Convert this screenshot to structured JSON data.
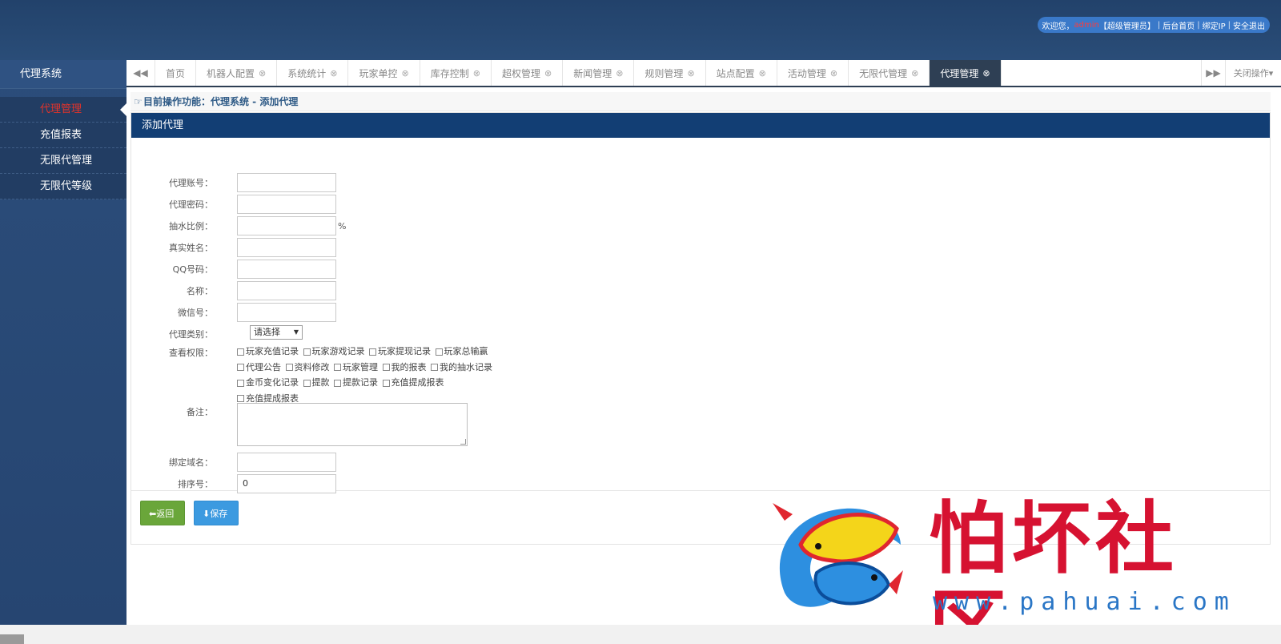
{
  "header": {
    "welcome": "欢迎您，",
    "username": "admin",
    "role": "【超级管理员】",
    "links": [
      "后台首页",
      "绑定IP",
      "安全退出"
    ]
  },
  "sidebar": {
    "title": "代理系统",
    "items": [
      {
        "label": "代理管理",
        "active": true
      },
      {
        "label": "充值报表"
      },
      {
        "label": "无限代管理"
      },
      {
        "label": "无限代等级"
      }
    ]
  },
  "tabs": [
    {
      "label": "首页",
      "closable": false
    },
    {
      "label": "机器人配置",
      "closable": true
    },
    {
      "label": "系统统计",
      "closable": true
    },
    {
      "label": "玩家单控",
      "closable": true
    },
    {
      "label": "库存控制",
      "closable": true
    },
    {
      "label": "超权管理",
      "closable": true
    },
    {
      "label": "新闻管理",
      "closable": true
    },
    {
      "label": "规则管理",
      "closable": true
    },
    {
      "label": "站点配置",
      "closable": true
    },
    {
      "label": "活动管理",
      "closable": true
    },
    {
      "label": "无限代管理",
      "closable": true
    },
    {
      "label": "代理管理",
      "closable": true,
      "active": true
    }
  ],
  "tabbar": {
    "close_ops_label": "关闭操作",
    "nav_left_icon": "double-left-arrow",
    "nav_right_icon": "double-right-arrow"
  },
  "breadcrumb": {
    "text": "目前操作功能：代理系统 - 添加代理"
  },
  "panel": {
    "title": "添加代理"
  },
  "form": {
    "account_label": "代理账号：",
    "password_label": "代理密码：",
    "ratio_label": "抽水比例：",
    "ratio_unit": "%",
    "realname_label": "真实姓名：",
    "qq_label": "QQ号码：",
    "name_label": "名称：",
    "wechat_label": "微信号：",
    "type_label": "代理类别：",
    "type_selected": "请选择",
    "perm_label": "查看权限：",
    "permissions": [
      "玩家充值记录",
      "玩家游戏记录",
      "玩家提现记录",
      "玩家总输赢",
      "代理公告",
      "资料修改",
      "玩家管理",
      "我的报表",
      "我的抽水记录",
      "金币变化记录",
      "提款",
      "提款记录",
      "充值提成报表",
      "充值提成报表"
    ],
    "remark_label": "备注：",
    "domain_label": "绑定域名：",
    "sort_label": "排序号：",
    "sort_value": "0"
  },
  "buttons": {
    "back": "返回",
    "save": "保存"
  },
  "watermark": {
    "text": "怕坏社区",
    "url": "www.pahuai.com"
  },
  "colors": {
    "header_bg": "#25466f",
    "sidebar_bg": "#2a4c79",
    "panel_head_bg": "#123e74",
    "active_tab_bg": "#2e3f54",
    "active_menu": "#e2332a",
    "back_btn": "#6aa63a",
    "save_btn": "#3c9ae0",
    "watermark_red": "#d61231"
  }
}
